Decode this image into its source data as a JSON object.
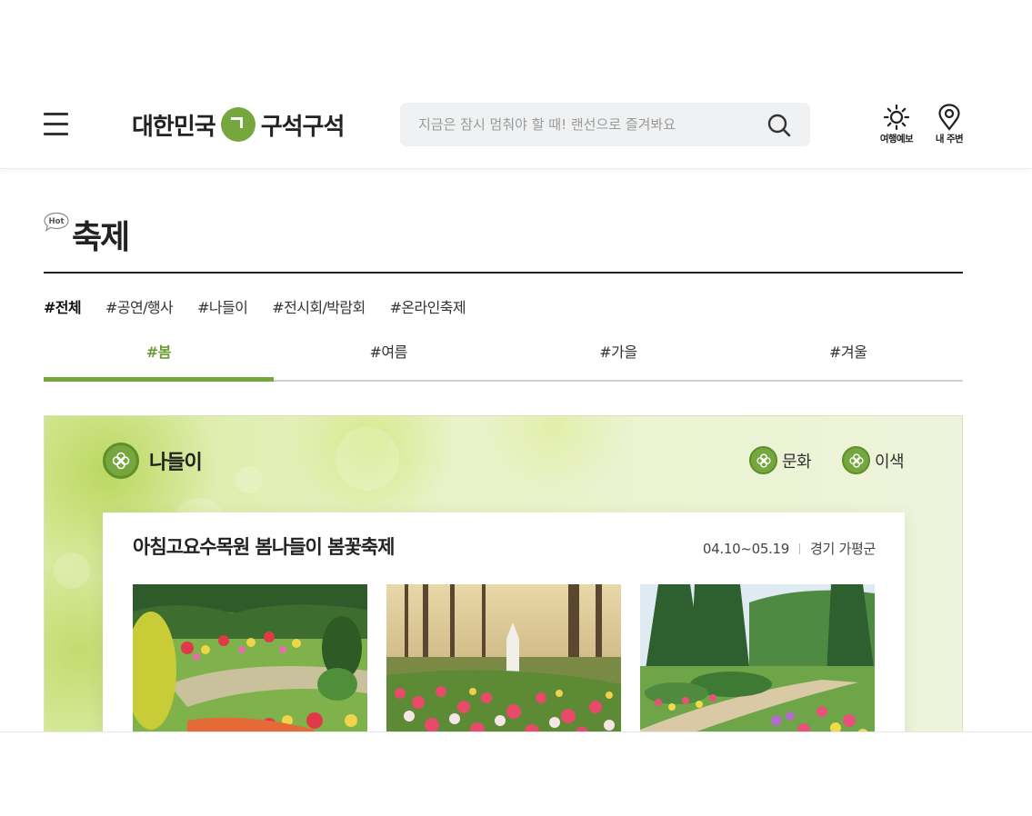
{
  "header": {
    "logo_left": "대한민국",
    "logo_right": "구석구석",
    "search_placeholder": "지금은 잠시 멈춰야 할 때! 랜선으로 즐겨봐요",
    "weather_label": "여행예보",
    "nearby_label": "내 주변"
  },
  "section": {
    "badge": "Hot",
    "title": "축제",
    "categories": [
      "#전체",
      "#공연/행사",
      "#나들이",
      "#전시회/박람회",
      "#온라인축제"
    ],
    "active_category": "#전체",
    "seasons": [
      "#봄",
      "#여름",
      "#가을",
      "#겨울"
    ],
    "active_season": "#봄"
  },
  "panel": {
    "theme_main": "나들이",
    "theme_culture": "문화",
    "theme_color": "이색",
    "card": {
      "title": "아침고요수목원 봄나들이 봄꽃축제",
      "date": "04.10~05.19",
      "location": "경기 가평군"
    }
  },
  "colors": {
    "accent_green": "#76a73e",
    "panel_bg": "#e9f2c8"
  }
}
